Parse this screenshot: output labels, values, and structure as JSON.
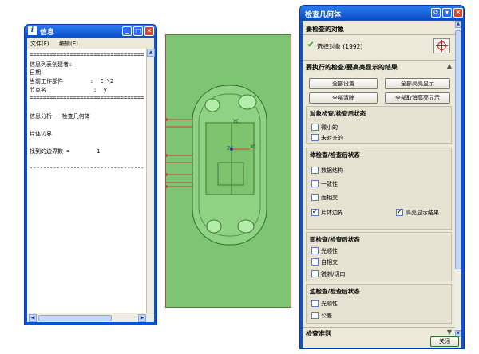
{
  "info_window": {
    "title": "信息",
    "menu": [
      "文件(F)",
      "编辑(E)"
    ],
    "lines": [
      "==================================",
      "信息列表创建者:",
      "日期",
      "当前工作部件        :  E:\\2",
      "节点名              :  y",
      "==================================",
      "",
      "信息分析 - 检查几何体",
      "",
      "片体边界",
      "",
      "找到的边界数 =        1",
      "",
      "----------------------------------"
    ]
  },
  "canvas": {
    "labels": {
      "yc": "YC",
      "xc": "XC",
      "zc": "ZC"
    }
  },
  "dialog": {
    "title": "检查几何体",
    "objects_section": "要检查的对象",
    "select_object": "选择对象 (1992)",
    "checks_section": "要执行的检查/要高亮显示的结果",
    "buttons": {
      "set_all": "全部设置",
      "highlight_all": "全部高亮显示",
      "clear_all": "全部清除",
      "unhighlight_all": "全部取消高亮显示"
    },
    "groups": [
      {
        "title": "对象检查/检查后状态",
        "items": [
          {
            "label": "微小的",
            "checked": false
          },
          {
            "label": "未对齐的",
            "checked": false
          }
        ]
      },
      {
        "title": "体检查/检查后状态",
        "items": [
          {
            "label": "数据结构",
            "checked": false
          },
          {
            "label": "一致性",
            "checked": false
          },
          {
            "label": "面相交",
            "checked": false
          },
          {
            "label": "片体边界",
            "checked": true
          }
        ],
        "extra": {
          "label": "高亮显示结果",
          "checked": true
        }
      },
      {
        "title": "面检查/检查后状态",
        "items": [
          {
            "label": "光顺性",
            "checked": false
          },
          {
            "label": "自相交",
            "checked": false
          },
          {
            "label": "锐刺/切口",
            "checked": false
          }
        ]
      },
      {
        "title": "边检查/检查后状态",
        "items": [
          {
            "label": "光顺性",
            "checked": false
          },
          {
            "label": "公差",
            "checked": false
          }
        ]
      }
    ],
    "check_criteria": "检查准则",
    "close_button": "关闭"
  },
  "colors": {
    "titlebar": "#0a4cc8",
    "canvas_bg": "#7dc473",
    "part": "#8fd283",
    "edge_highlight": "#d43c3c"
  }
}
